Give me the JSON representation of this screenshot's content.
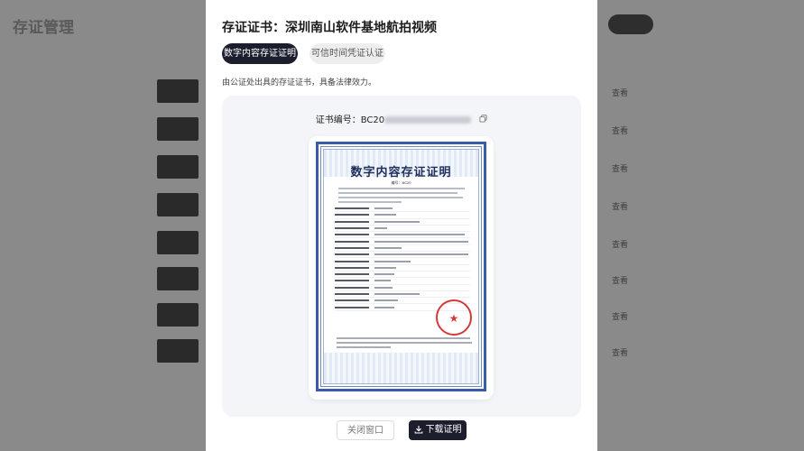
{
  "background": {
    "title": "存证管理",
    "row_links": [
      "查看",
      "查看",
      "查看",
      "查看",
      "查看",
      "查看",
      "查看",
      "查看"
    ]
  },
  "modal": {
    "title": "存证证书：深圳南山软件基地航拍视频",
    "tabs": [
      {
        "label": "数字内容存证证明",
        "active": true
      },
      {
        "label": "可信时间凭证认证",
        "active": false
      }
    ],
    "description": "由公证处出具的存证证书，具备法律效力。",
    "certificate": {
      "number_label": "证书编号：",
      "number_prefix": "BC20",
      "heading": "数字内容存证证明",
      "number_line": "编号：BC20",
      "seal_glyph": "★"
    },
    "buttons": {
      "close": "关闭窗口",
      "download": "下载证明"
    }
  },
  "colors": {
    "primary_dark": "#1c1e2e",
    "certificate_border": "#3a5ca8",
    "seal_red": "#d43a3a"
  }
}
